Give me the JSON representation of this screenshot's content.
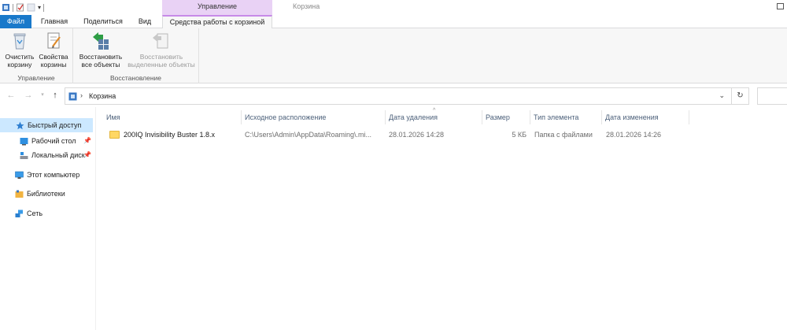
{
  "titlebar": {
    "context_header": "Управление",
    "window_title": "Корзина"
  },
  "tabs": {
    "file": "Файл",
    "home": "Главная",
    "share": "Поделиться",
    "view": "Вид",
    "recycle_tools": "Средства работы с корзиной"
  },
  "ribbon": {
    "manage_group": {
      "label": "Управление",
      "empty_bin": [
        "Очистить",
        "корзину"
      ],
      "bin_properties": [
        "Свойства",
        "корзины"
      ]
    },
    "restore_group": {
      "label": "Восстановление",
      "restore_all": [
        "Восстановить",
        "все объекты"
      ],
      "restore_selected": [
        "Восстановить",
        "выделенные объекты"
      ]
    }
  },
  "address": {
    "breadcrumb": "Корзина"
  },
  "navpane": {
    "quick_access": "Быстрый доступ",
    "desktop": "Рабочий стол",
    "local_disk": "Локальный диск",
    "this_pc": "Этот компьютер",
    "libraries": "Библиотеки",
    "network": "Сеть"
  },
  "columns": {
    "name": "Имя",
    "original_location": "Исходное расположение",
    "date_deleted": "Дата удаления",
    "size": "Размер",
    "item_type": "Тип элемента",
    "date_modified": "Дата изменения"
  },
  "rows": [
    {
      "name": "200IQ Invisibility Buster 1.8.x",
      "original_location": "C:\\Users\\Admin\\AppData\\Roaming\\.mi...",
      "date_deleted": "28.01.2026 14:28",
      "size": "5 КБ",
      "item_type": "Папка с файлами",
      "date_modified": "28.01.2026 14:26"
    }
  ],
  "colors": {
    "file_tab": "#1979ca",
    "context_tab": "#e9d2f5",
    "selected_nav": "#cce8ff",
    "header_text": "#4c607a"
  }
}
